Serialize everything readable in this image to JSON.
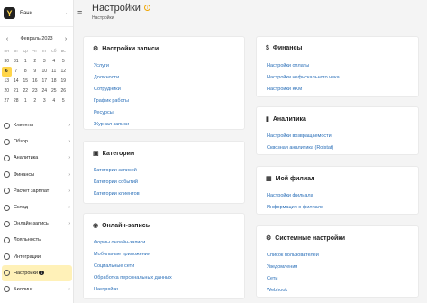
{
  "brand": {
    "name": "Бани",
    "chevron_icon": "chevron-down-icon"
  },
  "calendar": {
    "month": "Февраль 2023",
    "prev_icon": "chevron-left-icon",
    "next_icon": "chevron-right-icon",
    "dow": [
      "пн",
      "вт",
      "ср",
      "чт",
      "пт",
      "сб",
      "вс"
    ],
    "weeks": [
      [
        "30",
        "31",
        "1",
        "2",
        "3",
        "4",
        "5"
      ],
      [
        "6",
        "7",
        "8",
        "9",
        "10",
        "11",
        "12"
      ],
      [
        "13",
        "14",
        "15",
        "16",
        "17",
        "18",
        "19"
      ],
      [
        "20",
        "21",
        "22",
        "23",
        "24",
        "25",
        "26"
      ],
      [
        "27",
        "28",
        "1",
        "2",
        "3",
        "4",
        "5"
      ]
    ],
    "today": "6"
  },
  "menu": [
    {
      "label": "Клиенты",
      "icon": "users-icon",
      "chevron": "›"
    },
    {
      "label": "Обзор",
      "icon": "eye-icon",
      "chevron": "›"
    },
    {
      "label": "Аналитика",
      "icon": "chart-icon",
      "chevron": "›"
    },
    {
      "label": "Финансы",
      "icon": "dollar-icon",
      "chevron": "›"
    },
    {
      "label": "Расчет зарплат",
      "icon": "wallet-icon",
      "chevron": "›"
    },
    {
      "label": "Склад",
      "icon": "box-icon",
      "chevron": "›"
    },
    {
      "label": "Онлайн-запись",
      "icon": "globe-icon",
      "chevron": "›"
    },
    {
      "label": "Лояльность",
      "icon": "loyalty-icon",
      "chevron": ""
    },
    {
      "label": "Интеграции",
      "icon": "plug-icon",
      "chevron": ""
    },
    {
      "label": "Настройки",
      "icon": "gear-icon",
      "chevron": "",
      "badge": "1"
    },
    {
      "label": "Биллинг",
      "icon": "card-icon",
      "chevron": "›"
    }
  ],
  "header": {
    "title": "Настройки",
    "breadcrumb": "Настройки",
    "menu_icon": "hamburger-icon",
    "info_icon": "info-icon"
  },
  "cards": {
    "zapisi": {
      "icon": "gear-icon",
      "glyph": "⚙",
      "title": "Настройки записи",
      "links": [
        "Услуги",
        "Должности",
        "Сотрудники",
        "График работы",
        "Ресурсы",
        "Журнал записи"
      ]
    },
    "finance": {
      "icon": "dollar-icon",
      "glyph": "$",
      "title": "Финансы",
      "links": [
        "Настройки оплаты",
        "Настройки нефискального чека",
        "Настройки ККМ"
      ]
    },
    "analytics": {
      "icon": "chart-icon",
      "glyph": "▮",
      "title": "Аналитика",
      "links": [
        "Настройки возвращаемости",
        "Сквозная аналитика (Roistat)"
      ]
    },
    "categories": {
      "icon": "tag-icon",
      "glyph": "▣",
      "title": "Категории",
      "links": [
        "Категории записей",
        "Категории событий",
        "Категории клиентов"
      ]
    },
    "filial": {
      "icon": "building-icon",
      "glyph": "▦",
      "title": "Мой филиал",
      "links": [
        "Настройки филиала",
        "Информация о филиале"
      ]
    },
    "online": {
      "icon": "globe-icon",
      "glyph": "◉",
      "title": "Онлайн-запись",
      "links": [
        "Формы онлайн-записи",
        "Мобильные приложения",
        "Социальные сети",
        "Обработка персональных данных",
        "Настройки"
      ]
    },
    "system": {
      "icon": "settings-icon",
      "glyph": "⚙",
      "title": "Системные настройки",
      "links": [
        "Список пользователей",
        "Уведомления",
        "Сети",
        "Webhook"
      ]
    }
  }
}
